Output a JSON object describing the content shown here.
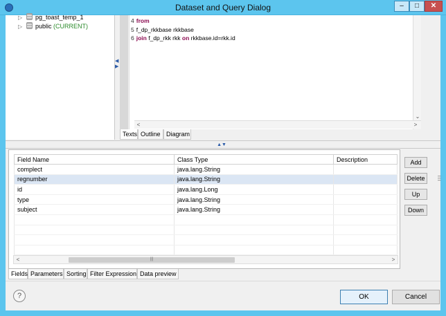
{
  "window": {
    "title": "Dataset and Query Dialog"
  },
  "tree": {
    "items": [
      {
        "label": "pg_toast_temp_1",
        "suffix": ""
      },
      {
        "label": "public",
        "suffix": "(CURRENT)"
      }
    ]
  },
  "editor": {
    "lines": [
      {
        "num": "4",
        "kw": "from",
        "text": ""
      },
      {
        "num": "5",
        "kw": "",
        "text": "f_dp_rkkbase rkkbase"
      },
      {
        "num": "6",
        "kw": "join",
        "text": "f_dp_rkk rkk",
        "kw2": "on",
        "text2": "rkkbase.id=rkk.id"
      }
    ],
    "tabs": [
      "Texts",
      "Outline",
      "Diagram"
    ]
  },
  "fields_table": {
    "headers": [
      "Field Name",
      "Class Type",
      "Description"
    ],
    "rows": [
      {
        "name": "complect",
        "type": "java.lang.String",
        "desc": ""
      },
      {
        "name": "regnumber",
        "type": "java.lang.String",
        "desc": ""
      },
      {
        "name": "id",
        "type": "java.lang.Long",
        "desc": ""
      },
      {
        "name": "type",
        "type": "java.lang.String",
        "desc": ""
      },
      {
        "name": "subject",
        "type": "java.lang.String",
        "desc": ""
      }
    ],
    "selected_row": 1
  },
  "side_buttons": {
    "add": "Add",
    "delete": "Delete",
    "up": "Up",
    "down": "Down"
  },
  "page_tabs": [
    "Fields",
    "Parameters",
    "Sorting",
    "Filter Expression",
    "Data preview"
  ],
  "footer": {
    "help": "?",
    "ok": "OK",
    "cancel": "Cancel"
  },
  "icons": [
    "app-icon",
    "minimize-icon",
    "maximize-icon",
    "close-icon",
    "database-icon",
    "help-icon"
  ]
}
